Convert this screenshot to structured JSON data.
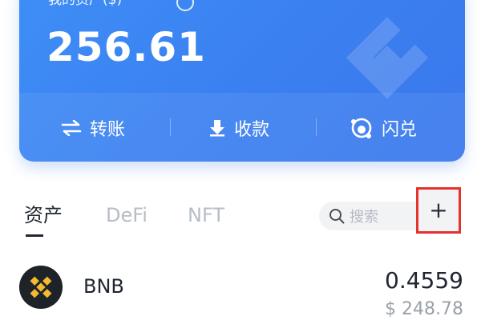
{
  "card": {
    "label": "我的资产($)",
    "balance": "256.61",
    "actions": [
      {
        "label": "转账",
        "icon": "transfer-icon"
      },
      {
        "label": "收款",
        "icon": "receive-icon"
      },
      {
        "label": "闪兑",
        "icon": "swap-icon"
      }
    ],
    "watermark_icon": "bnb-watermark-icon"
  },
  "tabs": [
    {
      "label": "资产",
      "active": true
    },
    {
      "label": "DeFi",
      "active": false
    },
    {
      "label": "NFT",
      "active": false
    }
  ],
  "search": {
    "placeholder": "搜索",
    "icon": "search-icon"
  },
  "add_button": {
    "label": "+",
    "highlight_color": "#e5322d"
  },
  "tokens": [
    {
      "name": "BNB",
      "amount": "0.4559",
      "value": "$ 248.78",
      "icon": "bnb-logo-icon"
    }
  ],
  "colors": {
    "card_blue": "#3b7ff0",
    "bnb_gold": "#f3ba2f",
    "text_dark": "#1f2430",
    "text_muted": "#9aa0a8"
  }
}
